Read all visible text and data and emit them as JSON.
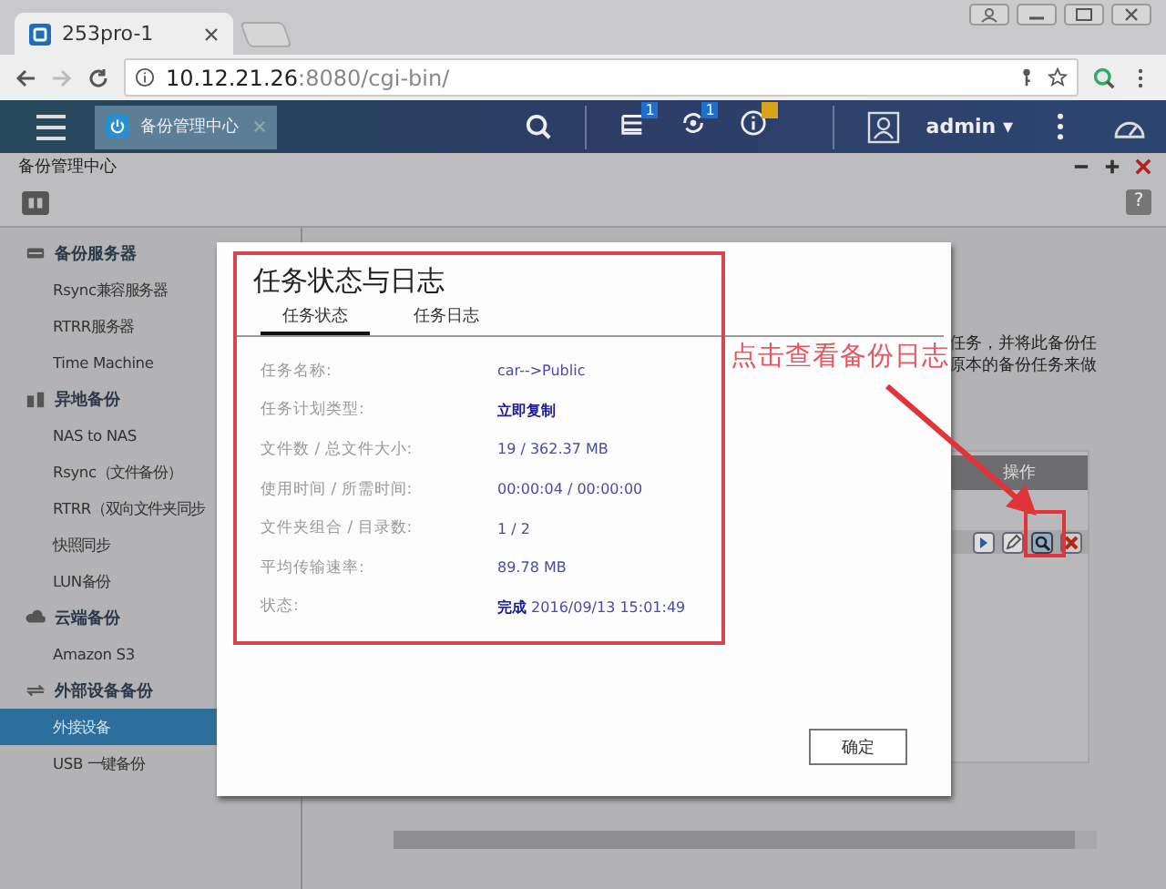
{
  "browser": {
    "tab_title": "253pro-1",
    "address": {
      "host": "10.12.21.26",
      "rest": ":8080/cgi-bin/"
    }
  },
  "app_header": {
    "app_tab": "备份管理中心",
    "notifications": [
      {
        "kind": "tasks",
        "badge": "1",
        "color": "#1e6fd0"
      },
      {
        "kind": "sync",
        "badge": "1",
        "color": "#1e6fd0"
      },
      {
        "kind": "info",
        "color": "#d9a41c"
      }
    ],
    "user": "admin",
    "user_caret": "▾"
  },
  "window": {
    "title": "备份管理中心",
    "help": "?"
  },
  "sidebar": {
    "groups": [
      {
        "kind": "server",
        "label": "备份服务器",
        "items": [
          {
            "label": "Rsync兼容服务器",
            "selected": false
          },
          {
            "label": "RTRR服务器",
            "selected": false
          },
          {
            "label": "Time Machine",
            "selected": false
          }
        ]
      },
      {
        "kind": "remote",
        "label": "异地备份",
        "items": [
          {
            "label": "NAS to NAS",
            "selected": false
          },
          {
            "label": "Rsync（文件备份）",
            "selected": false
          },
          {
            "label": "RTRR（双向文件夹同步",
            "selected": false
          },
          {
            "label": "快照同步",
            "selected": false
          },
          {
            "label": "LUN备份",
            "selected": false
          }
        ]
      },
      {
        "kind": "cloud",
        "label": "云端备份",
        "items": [
          {
            "label": "Amazon S3",
            "selected": false
          }
        ]
      },
      {
        "kind": "external",
        "label": "外部设备备份",
        "items": [
          {
            "label": "外接设备",
            "selected": true
          },
          {
            "label": "USB 一键备份",
            "selected": false
          }
        ]
      }
    ]
  },
  "background": {
    "description_lines": [
      "任务，并将此备份任",
      "原本的备份任务来做"
    ],
    "table": {
      "columns": [
        "操作"
      ],
      "row_actions": [
        {
          "kind": "start"
        },
        {
          "kind": "edit"
        },
        {
          "kind": "log"
        },
        {
          "kind": "delete"
        }
      ]
    }
  },
  "dialog": {
    "title": "任务状态与日志",
    "tabs": [
      {
        "label": "任务状态",
        "selected": true
      },
      {
        "label": "任务日志",
        "selected": false
      }
    ],
    "fields": [
      {
        "label": "任务名称:",
        "value": "car-->Public"
      },
      {
        "label": "任务计划类型:",
        "value": "**立即复制**"
      },
      {
        "label": "文件数 / 总文件大小:",
        "value": "19 / 362.37 MB"
      },
      {
        "label": "使用时间 / 所需时间:",
        "value": "00:00:04 / 00:00:00"
      },
      {
        "label": "文件夹组合 / 目录数:",
        "value": "1 / 2"
      },
      {
        "label": "平均传输速率:",
        "value": "89.78 MB"
      },
      {
        "label": "状态:",
        "value": "**完成** 2016/09/13 15:01:49"
      }
    ],
    "ok_button": "确定"
  },
  "annotation": {
    "text": "点击查看备份日志"
  }
}
